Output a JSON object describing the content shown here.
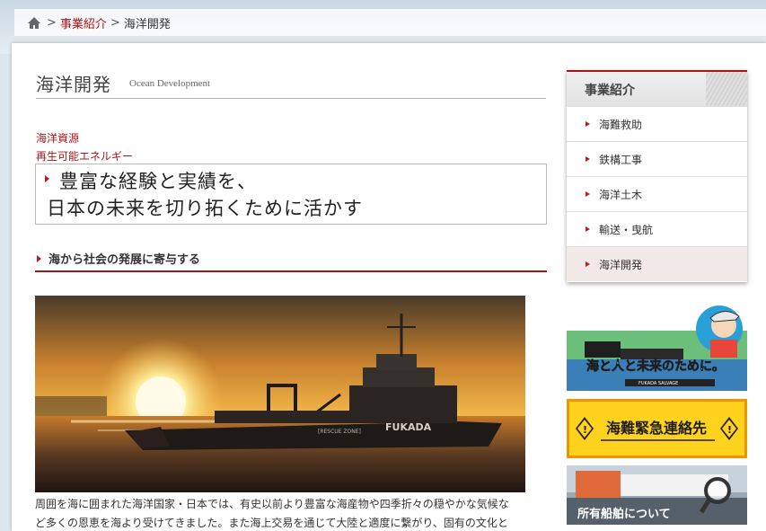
{
  "breadcrumb": {
    "home_icon": "home-icon",
    "sep1": ">",
    "item1": "事業紹介",
    "sep2": ">",
    "current": "海洋開発"
  },
  "page": {
    "title_jp": "海洋開発",
    "title_en": "Ocean Development"
  },
  "categories": [
    "海洋資源",
    "再生可能エネルギー"
  ],
  "headline": {
    "line1": "豊富な経験と実績を、",
    "line2": "日本の未来を切り拓くために活かす"
  },
  "section": {
    "heading": "海から社会の発展に寄与する"
  },
  "photo": {
    "ship_name": "FUKADA",
    "deck_label": "[RESCUE ZONE]"
  },
  "body": {
    "line1": "周囲を海に囲まれた海洋国家・日本では、有史以前より豊富な海産物や四季折々の穏やかな気候な",
    "line2": "ど多くの恩恵を海より受けてきました。また海上交易を通じて大陸と適度に繋がり、固有の文化と"
  },
  "sidebar": {
    "heading": "事業紹介",
    "items": [
      {
        "label": "海難救助"
      },
      {
        "label": "鉄構工事"
      },
      {
        "label": "海洋土木"
      },
      {
        "label": "輸送・曳航"
      },
      {
        "label": "海洋開発"
      }
    ]
  },
  "banners": {
    "banner1_text": "海と人と未来のために。",
    "banner1_small": "FUKADA SALVAGE",
    "banner2_text": "海難緊急連絡先",
    "banner3_text": "所有船舶について"
  },
  "colors": {
    "accent": "#a4161a",
    "banner2_bg": "#ffd21e",
    "banner2_border": "#f39200"
  }
}
